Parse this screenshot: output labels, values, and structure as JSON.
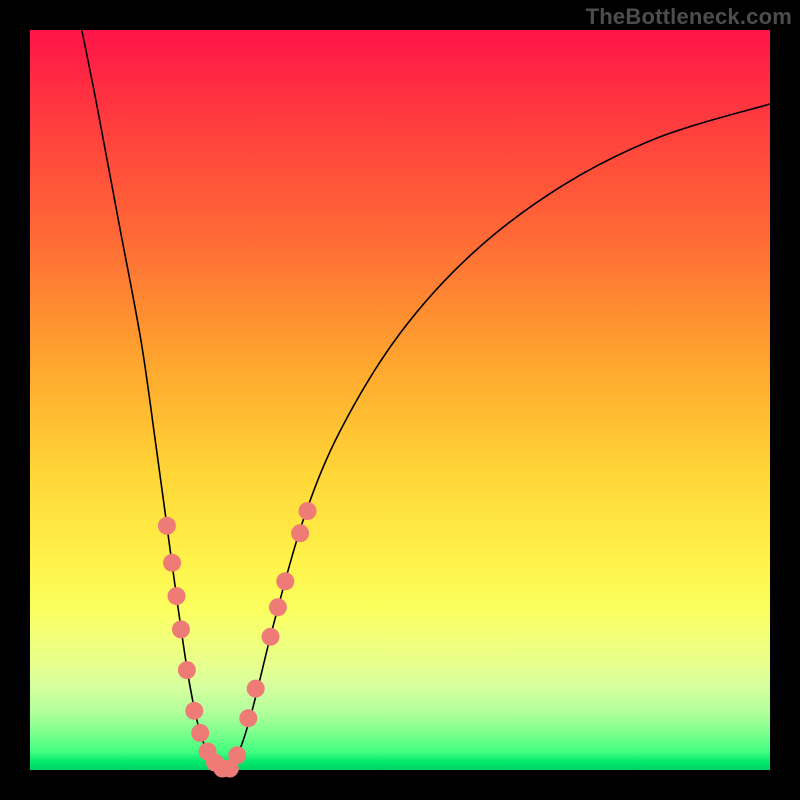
{
  "watermark": "TheBottleneck.com",
  "chart_data": {
    "type": "line",
    "title": "",
    "xlabel": "",
    "ylabel": "",
    "xlim": [
      0,
      100
    ],
    "ylim": [
      0,
      100
    ],
    "grid": false,
    "legend": false,
    "curves": [
      {
        "name": "left-limb",
        "points": [
          {
            "x": 7.0,
            "y": 100.0
          },
          {
            "x": 9.0,
            "y": 90.0
          },
          {
            "x": 12.0,
            "y": 74.0
          },
          {
            "x": 15.0,
            "y": 58.0
          },
          {
            "x": 17.0,
            "y": 44.0
          },
          {
            "x": 18.5,
            "y": 33.0
          },
          {
            "x": 20.0,
            "y": 22.0
          },
          {
            "x": 21.5,
            "y": 12.0
          },
          {
            "x": 23.0,
            "y": 5.0
          },
          {
            "x": 24.5,
            "y": 1.5
          },
          {
            "x": 26.0,
            "y": 0.0
          }
        ]
      },
      {
        "name": "right-limb",
        "points": [
          {
            "x": 26.0,
            "y": 0.0
          },
          {
            "x": 28.0,
            "y": 2.0
          },
          {
            "x": 30.0,
            "y": 8.0
          },
          {
            "x": 33.0,
            "y": 20.0
          },
          {
            "x": 37.0,
            "y": 34.0
          },
          {
            "x": 42.0,
            "y": 46.0
          },
          {
            "x": 50.0,
            "y": 59.0
          },
          {
            "x": 60.0,
            "y": 70.0
          },
          {
            "x": 72.0,
            "y": 79.0
          },
          {
            "x": 85.0,
            "y": 85.5
          },
          {
            "x": 100.0,
            "y": 90.0
          }
        ]
      }
    ],
    "markers": [
      {
        "x": 18.5,
        "y": 33.0
      },
      {
        "x": 19.2,
        "y": 28.0
      },
      {
        "x": 19.8,
        "y": 23.5
      },
      {
        "x": 20.4,
        "y": 19.0
      },
      {
        "x": 21.2,
        "y": 13.5
      },
      {
        "x": 22.2,
        "y": 8.0
      },
      {
        "x": 23.0,
        "y": 5.0
      },
      {
        "x": 24.0,
        "y": 2.5
      },
      {
        "x": 25.0,
        "y": 1.0
      },
      {
        "x": 26.0,
        "y": 0.2
      },
      {
        "x": 27.0,
        "y": 0.2
      },
      {
        "x": 28.0,
        "y": 2.0
      },
      {
        "x": 29.5,
        "y": 7.0
      },
      {
        "x": 30.5,
        "y": 11.0
      },
      {
        "x": 32.5,
        "y": 18.0
      },
      {
        "x": 33.5,
        "y": 22.0
      },
      {
        "x": 34.5,
        "y": 25.5
      },
      {
        "x": 36.5,
        "y": 32.0
      },
      {
        "x": 37.5,
        "y": 35.0
      }
    ],
    "curve_style": {
      "stroke": "#000000",
      "width": 1.6
    },
    "marker_style": {
      "fill": "#ef7b77",
      "radius_px": 9
    }
  }
}
